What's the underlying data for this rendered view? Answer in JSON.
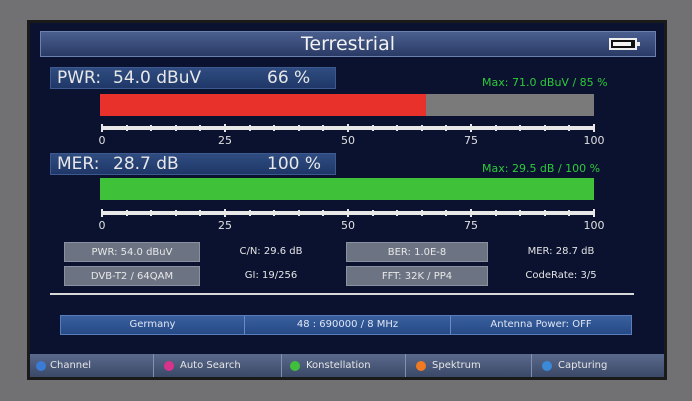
{
  "screen": {
    "title": "Terrestrial",
    "battery_level": 0.9
  },
  "pwr": {
    "label": "PWR:",
    "value": "54.0 dBuV",
    "percent": "66 %",
    "level": 66,
    "max": "Max: 71.0 dBuV / 85 %",
    "color": "#e8312a"
  },
  "mer": {
    "label": "MER:",
    "value": "28.7 dB",
    "percent": "100 %",
    "level": 100,
    "max": "Max: 29.5 dB / 100 %",
    "color": "#3fc23a"
  },
  "scale_labels": [
    "0",
    "25",
    "50",
    "75",
    "100"
  ],
  "info": {
    "pwr": "PWR: 54.0 dBuV",
    "cn": "C/N: 29.6 dB",
    "ber": "BER: 1.0E-8",
    "mer": "MER: 28.7 dB",
    "system": "DVB-T2 / 64QAM",
    "gi": "GI: 19/256",
    "fft": "FFT: 32K / PP4",
    "coderate": "CodeRate: 3/5"
  },
  "region": {
    "country": "Germany",
    "channel": "48 : 690000 / 8 MHz",
    "antenna": "Antenna Power: OFF"
  },
  "functions": [
    {
      "label": "Channel",
      "color": "#3a7bd5"
    },
    {
      "label": "Auto Search",
      "color": "#d8338a"
    },
    {
      "label": "Konstellation",
      "color": "#3fbf3a"
    },
    {
      "label": "Spektrum",
      "color": "#f07a22"
    },
    {
      "label": "Capturing",
      "color": "#3a8ad8"
    }
  ]
}
